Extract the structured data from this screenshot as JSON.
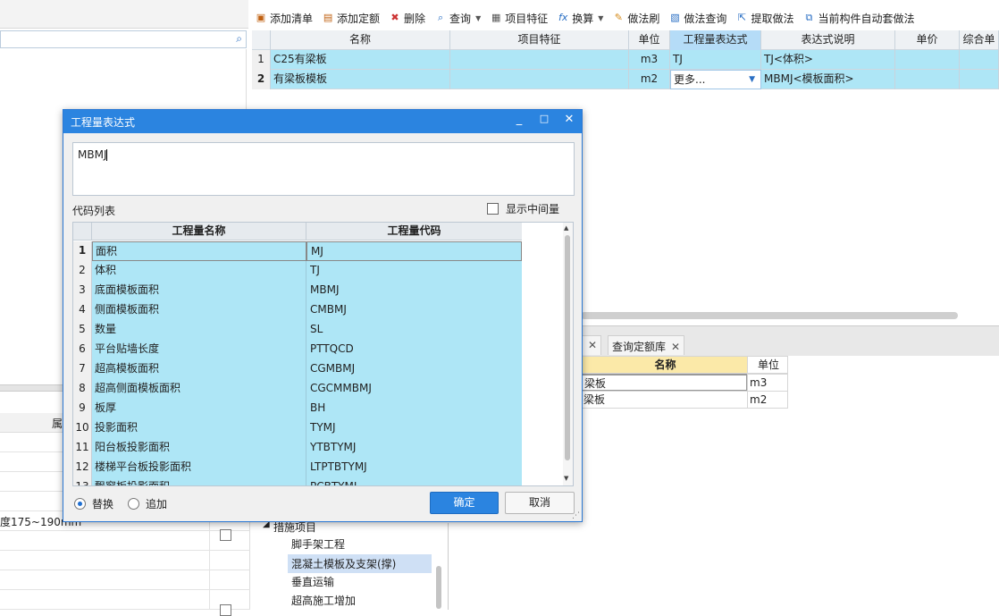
{
  "left_panel": {
    "search_icon": "search-icon",
    "bottom_header_label": "属",
    "bottom_row_text": "度175~190mm"
  },
  "toolbar": {
    "items": [
      {
        "label": "添加清单",
        "icon": "add-list-icon"
      },
      {
        "label": "添加定额",
        "icon": "add-quota-icon"
      },
      {
        "label": "删除",
        "icon": "delete-icon"
      },
      {
        "label": "查询",
        "icon": "query-icon",
        "dropdown": true
      },
      {
        "label": "项目特征",
        "icon": "feature-icon"
      },
      {
        "label": "换算",
        "icon": "fx-icon",
        "dropdown": true
      },
      {
        "label": "做法刷",
        "icon": "brush-icon"
      },
      {
        "label": "做法查询",
        "icon": "method-query-icon"
      },
      {
        "label": "提取做法",
        "icon": "extract-icon"
      },
      {
        "label": "当前构件自动套做法",
        "icon": "auto-apply-icon"
      }
    ]
  },
  "grid": {
    "headers": [
      "名称",
      "项目特征",
      "单位",
      "工程量表达式",
      "表达式说明",
      "单价",
      "综合单"
    ],
    "rows": [
      {
        "num": "1",
        "name": "C25有梁板",
        "feature": "",
        "unit": "m3",
        "expr": "TJ",
        "desc": "TJ<体积>"
      },
      {
        "num": "2",
        "name": "有梁板模板",
        "feature": "",
        "unit": "m2",
        "expr": "更多...",
        "desc": "MBMJ<模板面积>"
      }
    ]
  },
  "tabs": [
    {
      "label": "",
      "close": "✕"
    },
    {
      "label": "查询定额库",
      "close": "✕"
    }
  ],
  "quota_table": {
    "headers": [
      "名称",
      "单位"
    ],
    "rows": [
      {
        "name": "梁板",
        "unit": "m3"
      },
      {
        "name": "梁板",
        "unit": "m2"
      }
    ]
  },
  "measure_tree": {
    "group_label": "措施项目",
    "items": [
      "脚手架工程",
      "混凝土模板及支架(撑)",
      "垂直运输",
      "超高施工增加"
    ],
    "selected_index": 1
  },
  "dialog": {
    "title": "工程量表达式",
    "window_buttons": {
      "minimize": "_",
      "maximize": "□",
      "close": "✕"
    },
    "expression_value": "MBMJ",
    "code_list_label": "代码列表",
    "show_intermediate_label": "显示中间量",
    "table_headers": [
      "工程量名称",
      "工程量代码"
    ],
    "rows": [
      {
        "num": "1",
        "name": "面积",
        "code": "MJ"
      },
      {
        "num": "2",
        "name": "体积",
        "code": "TJ"
      },
      {
        "num": "3",
        "name": "底面模板面积",
        "code": "MBMJ"
      },
      {
        "num": "4",
        "name": "侧面模板面积",
        "code": "CMBMJ"
      },
      {
        "num": "5",
        "name": "数量",
        "code": "SL"
      },
      {
        "num": "6",
        "name": "平台贴墙长度",
        "code": "PTTQCD"
      },
      {
        "num": "7",
        "name": "超高模板面积",
        "code": "CGMBMJ"
      },
      {
        "num": "8",
        "name": "超高侧面模板面积",
        "code": "CGCMMBMJ"
      },
      {
        "num": "9",
        "name": "板厚",
        "code": "BH"
      },
      {
        "num": "10",
        "name": "投影面积",
        "code": "TYMJ"
      },
      {
        "num": "11",
        "name": "阳台板投影面积",
        "code": "YTBTYMJ"
      },
      {
        "num": "12",
        "name": "楼梯平台板投影面积",
        "code": "LTPTBTYMJ"
      },
      {
        "num": "13",
        "name": "飘窗板投影面积",
        "code": "PCBTYMJ"
      }
    ],
    "radio_replace": "替换",
    "radio_append": "追加",
    "ok_label": "确定",
    "cancel_label": "取消"
  },
  "colors": {
    "accent": "#2b84e0",
    "row_highlight": "#aee6f6",
    "header_selected": "#b5dcf7"
  }
}
